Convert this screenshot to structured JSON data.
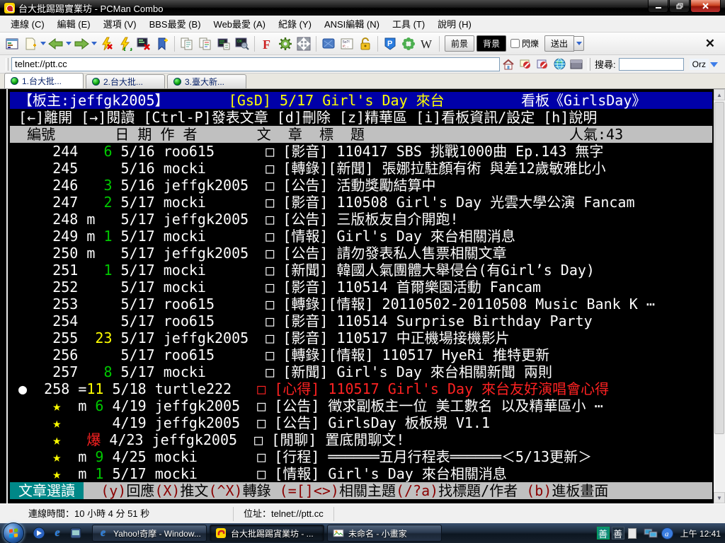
{
  "window": {
    "title": "台大批踢踢實業坊 - PCMan Combo"
  },
  "menu_items": [
    "連線 (C)",
    "編輯 (E)",
    "選項 (V)",
    "BBS最愛 (B)",
    "Web最愛 (A)",
    "紀錄 (Y)",
    "ANSI編輯 (N)",
    "工具 (T)",
    "說明 (H)"
  ],
  "toolbar": {
    "fg_label": "前景",
    "bg_label": "背景",
    "blink_label": "閃爍",
    "send_label": "送出",
    "close_label": "✕"
  },
  "address": {
    "url": "telnet://ptt.cc",
    "search_label": "搜尋:",
    "search_value": "",
    "engine_label": "Orz"
  },
  "tabs": [
    {
      "label": "1.台大批..."
    },
    {
      "label": "2.台大批..."
    },
    {
      "label": "3.臺大新..."
    }
  ],
  "colors": {
    "palette": {
      "w": "#ffffff",
      "g": "#00c800",
      "y": "#ffff00",
      "r": "#ff2222",
      "k": "#000000",
      "m": "#8b0000"
    },
    "backgrounds": {
      "blue": "#0000a8",
      "gray": "#c0c0c0",
      "teal": "#008888"
    }
  },
  "terminal": {
    "lines": [
      {
        "name": "board-title-line",
        "bg": "blue",
        "segs": [
          {
            "t": " 【板主:jeffgk2005】       ",
            "c": "w"
          },
          {
            "t": "[GsD] 5/17 Girl's Day 來台",
            "c": "y"
          },
          {
            "t": "         ",
            "c": "w"
          },
          {
            "t": "看板《GirlsDay》",
            "c": "w"
          }
        ]
      },
      {
        "name": "help-line",
        "segs": [
          {
            "t": " [←]離開 [→]閱讀 [Ctrl-P]發表文章 [d]刪除 [z]精華區 [i]看板資訊/設定 [h]說明",
            "c": "w"
          }
        ]
      },
      {
        "name": "column-header-line",
        "bg": "gray",
        "segs": [
          {
            "t": "  編號       日 期 作 者       文  章  標  題                        人氣:43",
            "c": "k"
          }
        ]
      },
      {
        "row": true,
        "segs": [
          {
            "t": "     244  ",
            "c": "w"
          },
          {
            "t": " 6",
            "c": "g"
          },
          {
            "t": " 5/16 roo615      ",
            "c": "w"
          },
          {
            "t": "□ ",
            "c": "w"
          },
          {
            "t": "[影音] 110417 SBS 挑戰1000曲 Ep.143 無字",
            "c": "w"
          }
        ]
      },
      {
        "row": true,
        "segs": [
          {
            "t": "     245     5/16 mocki       ",
            "c": "w"
          },
          {
            "t": "□ ",
            "c": "w"
          },
          {
            "t": "[轉錄][新聞] 張娜拉駐顏有術 與差12歲敏雅比小",
            "c": "w"
          }
        ]
      },
      {
        "row": true,
        "segs": [
          {
            "t": "     246  ",
            "c": "w"
          },
          {
            "t": " 3",
            "c": "g"
          },
          {
            "t": " 5/16 jeffgk2005  ",
            "c": "w"
          },
          {
            "t": "□ ",
            "c": "w"
          },
          {
            "t": "[公告] 活動獎勵結算中",
            "c": "w"
          }
        ]
      },
      {
        "row": true,
        "segs": [
          {
            "t": "     247  ",
            "c": "w"
          },
          {
            "t": " 2",
            "c": "g"
          },
          {
            "t": " 5/17 mocki       ",
            "c": "w"
          },
          {
            "t": "□ ",
            "c": "w"
          },
          {
            "t": "[影音] 110508 Girl's Day 光雲大學公演 Fancam",
            "c": "w"
          }
        ]
      },
      {
        "row": true,
        "segs": [
          {
            "t": "     248 m   5/17 jeffgk2005  ",
            "c": "w"
          },
          {
            "t": "□ ",
            "c": "w"
          },
          {
            "t": "[公告] 三版板友自介開跑!",
            "c": "w"
          }
        ]
      },
      {
        "row": true,
        "segs": [
          {
            "t": "     248 m",
            "c": "w"
          }
        ],
        "hidden": true
      },
      {
        "row": true,
        "segs": [
          {
            "t": "     250 m   5/17 jeffgk2005  ",
            "c": "w"
          },
          {
            "t": "□ ",
            "c": "w"
          },
          {
            "t": "[公告] 請勿發表私人售票相關文章",
            "c": "w"
          }
        ]
      },
      {
        "row": true,
        "segs": [
          {
            "t": "     251  ",
            "c": "w"
          },
          {
            "t": " 1",
            "c": "g"
          },
          {
            "t": " 5/17 mocki       ",
            "c": "w"
          },
          {
            "t": "□ ",
            "c": "w"
          },
          {
            "t": "[新聞] 韓國人氣團體大舉侵台(有Girl’s Day)",
            "c": "w"
          }
        ]
      },
      {
        "row": true,
        "segs": [
          {
            "t": "     252     5/17 mocki       ",
            "c": "w"
          },
          {
            "t": "□ ",
            "c": "w"
          },
          {
            "t": "[影音] 110514 首爾樂園活動 Fancam",
            "c": "w"
          }
        ]
      },
      {
        "row": true,
        "segs": [
          {
            "t": "     253     5/17 roo615      ",
            "c": "w"
          },
          {
            "t": "□ ",
            "c": "w"
          },
          {
            "t": "[轉錄][情報] 20110502-20110508 Music Bank K ⋯",
            "c": "w"
          }
        ]
      },
      {
        "row": true,
        "segs": [
          {
            "t": "     254     5/17 roo615      ",
            "c": "w"
          },
          {
            "t": "□ ",
            "c": "w"
          },
          {
            "t": "[影音] 110514 Surprise Birthday Party",
            "c": "w"
          }
        ]
      },
      {
        "row": true,
        "segs": [
          {
            "t": "     255  ",
            "c": "w"
          },
          {
            "t": "23",
            "c": "y"
          },
          {
            "t": " 5/17 jeffgk2005  ",
            "c": "w"
          },
          {
            "t": "□ ",
            "c": "w"
          },
          {
            "t": "[影音] 110517 中正機場接機影片",
            "c": "w"
          }
        ]
      },
      {
        "row": true,
        "segs": [
          {
            "t": "     256     5/17 roo615      ",
            "c": "w"
          },
          {
            "t": "□ ",
            "c": "w"
          },
          {
            "t": "[轉錄][情報] 110517 HyeRi 推特更新",
            "c": "w"
          }
        ]
      },
      {
        "row": true,
        "segs": [
          {
            "t": "     257  ",
            "c": "w"
          },
          {
            "t": " 8",
            "c": "g"
          },
          {
            "t": " 5/17 mocki       ",
            "c": "w"
          },
          {
            "t": "□ ",
            "c": "w"
          },
          {
            "t": "[新聞] Girl's Day 來台相關新聞 兩則",
            "c": "w"
          }
        ]
      },
      {
        "row": true,
        "cursor": true,
        "segs": [
          {
            "t": " ●  258 ",
            "c": "w"
          },
          {
            "t": "=",
            "c": "w"
          },
          {
            "t": "11",
            "c": "y"
          },
          {
            "t": " 5/18 turtle222   ",
            "c": "w"
          },
          {
            "t": "□ ",
            "c": "r"
          },
          {
            "t": "[心得] 110517 Girl's Day 來台友好演唱會心得",
            "c": "r"
          }
        ]
      },
      {
        "row": true,
        "segs": [
          {
            "t": "     ★  ",
            "c": "y"
          },
          {
            "t": "m",
            "c": "w"
          },
          {
            "t": " 6",
            "c": "g"
          },
          {
            "t": " 4/19 jeffgk2005  ",
            "c": "w"
          },
          {
            "t": "□ ",
            "c": "w"
          },
          {
            "t": "[公告] 徵求副板主一位 美工數名 以及精華區小 ⋯",
            "c": "w"
          }
        ]
      },
      {
        "row": true,
        "segs": [
          {
            "t": "     ★  ",
            "c": "y"
          },
          {
            "t": "    4/19 jeffgk2005  ",
            "c": "w"
          },
          {
            "t": "□ ",
            "c": "w"
          },
          {
            "t": "[公告] GirlsDay 板板規 V1.1",
            "c": "w"
          }
        ]
      },
      {
        "row": true,
        "segs": [
          {
            "t": "     ★  ",
            "c": "y"
          },
          {
            "t": " ",
            "c": "w"
          },
          {
            "t": "爆",
            "c": "r"
          },
          {
            "t": " 4/23 jeffgk2005  ",
            "c": "w"
          },
          {
            "t": "□ ",
            "c": "w"
          },
          {
            "t": "[閒聊] 置底閒聊文!",
            "c": "w"
          }
        ]
      },
      {
        "row": true,
        "segs": [
          {
            "t": "     ★  ",
            "c": "y"
          },
          {
            "t": "m",
            "c": "w"
          },
          {
            "t": " 9",
            "c": "g"
          },
          {
            "t": " 4/25 mocki       ",
            "c": "w"
          },
          {
            "t": "□ ",
            "c": "w"
          },
          {
            "t": "[行程] ══════五月行程表══════＜5/13更新＞",
            "c": "w"
          }
        ]
      },
      {
        "row": true,
        "segs": [
          {
            "t": "     ★  ",
            "c": "y"
          },
          {
            "t": "m",
            "c": "w"
          },
          {
            "t": " 1",
            "c": "g"
          },
          {
            "t": " 5/17 mocki       ",
            "c": "w"
          },
          {
            "t": "□ ",
            "c": "w"
          },
          {
            "t": "[情報] Girl's Day 來台相關消息",
            "c": "w"
          }
        ]
      },
      {
        "name": "command-line",
        "bg": "gray",
        "segs": [
          {
            "t": " 文章選讀 ",
            "c": "w",
            "bg": "teal"
          },
          {
            "t": "  ",
            "c": "k"
          },
          {
            "t": "(y)",
            "c": "m"
          },
          {
            "t": "回應",
            "c": "k"
          },
          {
            "t": "(X)",
            "c": "m"
          },
          {
            "t": "推文",
            "c": "k"
          },
          {
            "t": "(^X)",
            "c": "m"
          },
          {
            "t": "轉錄 ",
            "c": "k"
          },
          {
            "t": "(=[]<>)",
            "c": "m"
          },
          {
            "t": "相關主題",
            "c": "k"
          },
          {
            "t": "(/?a)",
            "c": "m"
          },
          {
            "t": "找標題/作者 ",
            "c": "k"
          },
          {
            "t": "(b)",
            "c": "m"
          },
          {
            "t": "進板畫面",
            "c": "k"
          }
        ]
      }
    ]
  },
  "fix_line_249": {
    "row": true,
    "segs": [
      {
        "t": "     249 m",
        "c": "w"
      },
      {
        "t": " 1",
        "c": "g"
      },
      {
        "t": " 5/17 mocki       ",
        "c": "w"
      },
      {
        "t": "□ ",
        "c": "w"
      },
      {
        "t": "[情報] Girl's Day 來台相關消息",
        "c": "w"
      }
    ]
  },
  "status": {
    "conn_label": "連線時間：10 小時 4 分 51 秒",
    "addr_label": "位址：telnet://ptt.cc"
  },
  "taskbar": {
    "tasks": [
      {
        "label": "Yahoo!奇摩 - Window...",
        "icon": "ie"
      },
      {
        "label": "台大批踢踢寊業坊 - ...",
        "icon": "pcman",
        "active": true
      },
      {
        "label": "未命名 - 小畫家",
        "icon": "paint"
      }
    ],
    "tray": {
      "ime1": "善",
      "ime2": "善",
      "time": "上午 12:41"
    }
  }
}
